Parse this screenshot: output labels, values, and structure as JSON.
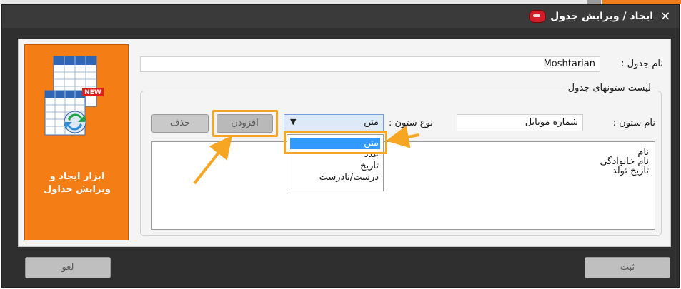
{
  "window": {
    "title": "ایجاد / ویرایش جدول",
    "close_glyph": "×"
  },
  "sidebar": {
    "caption": "ابزار ایجاد و\nویرایش جداول",
    "icon_badge": "NEW"
  },
  "form": {
    "table_name_label": "نام جدول :",
    "table_name_value": "Moshtarian",
    "group_label": "لیست ستونهای جدول",
    "column_name_label": "نام ستون :",
    "column_name_value": "شماره موبایل",
    "column_type_label": "نوع ستون :",
    "column_type_value": "متن",
    "add_button": "افزودن",
    "delete_button": "حذف",
    "columns_list": [
      "نام",
      "نام خانوادگی",
      "تاریخ تولد"
    ],
    "type_options": [
      "متن",
      "عدد",
      "تاریخ",
      "درست/نادرست"
    ]
  },
  "footer": {
    "save_button": "ثبت",
    "cancel_button": "لغو"
  },
  "colors": {
    "highlight": "#f6a623",
    "accent": "#f47d16",
    "selected": "#3399ff"
  }
}
